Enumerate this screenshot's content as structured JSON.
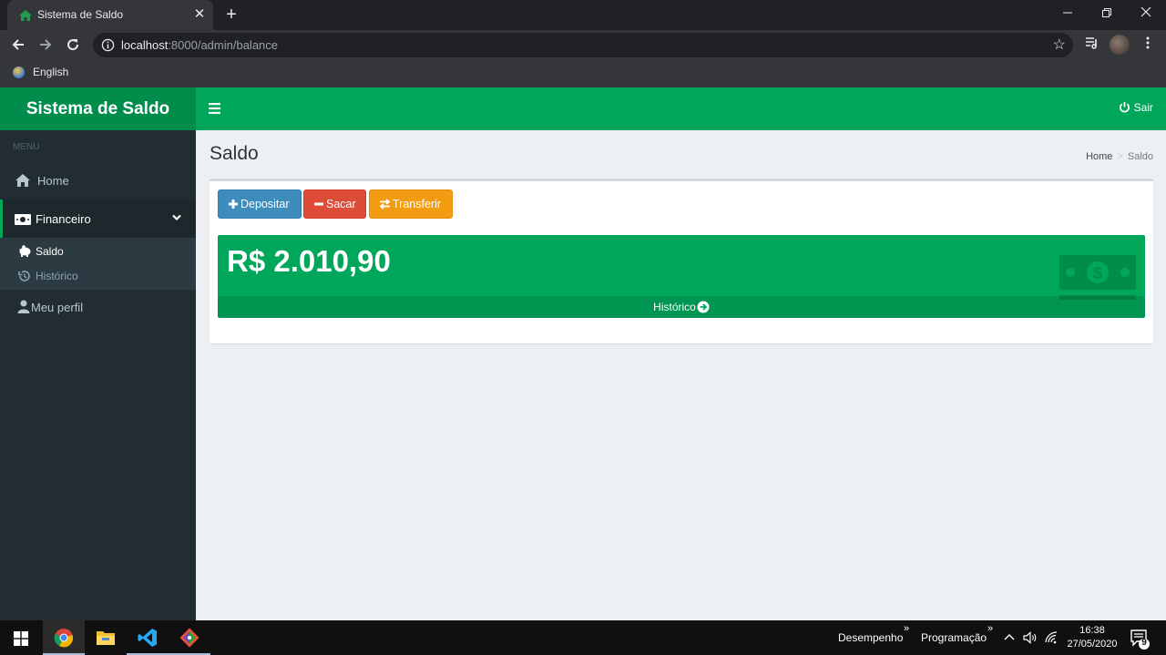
{
  "browser": {
    "tab_title": "Sistema de Saldo",
    "tab_close": "✕",
    "new_tab": "+",
    "url_host": "localhost",
    "url_path": ":8000/admin/balance",
    "bookmark_label": "English"
  },
  "app": {
    "logo": "Sistema de Saldo",
    "logout_label": "Sair",
    "brand_color": "#00a65a",
    "logo_color": "#008d4c"
  },
  "sidebar": {
    "header": "MENU",
    "items": [
      {
        "label": "Home",
        "icon": "home-icon"
      },
      {
        "label": "Financeiro",
        "icon": "money-icon"
      },
      {
        "label": "Meu perfil",
        "icon": "user-icon"
      }
    ],
    "submenu": [
      {
        "label": "Saldo",
        "icon": "piggy-bank-icon"
      },
      {
        "label": "Histórico",
        "icon": "history-icon"
      }
    ]
  },
  "page": {
    "title": "Saldo",
    "breadcrumb": [
      "Home",
      "Saldo"
    ]
  },
  "actions": {
    "deposit": "Depositar",
    "withdraw": "Sacar",
    "transfer": "Transferir"
  },
  "balance": {
    "amount": "R$ 2.010,90",
    "footer_link": "Histórico"
  },
  "taskbar": {
    "toolbar1": "Desempenho",
    "toolbar2": "Programação",
    "time": "16:38",
    "date": "27/05/2020",
    "notifications": "9"
  }
}
